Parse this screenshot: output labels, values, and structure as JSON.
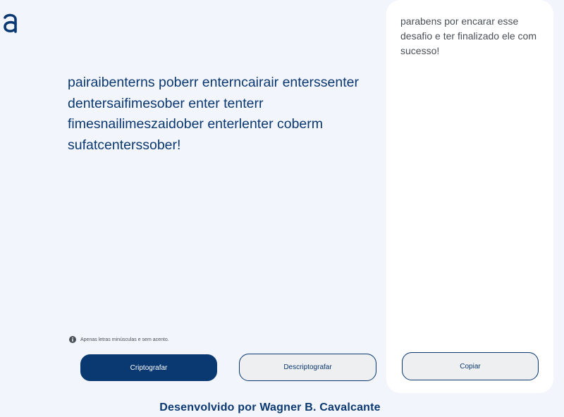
{
  "app": {
    "logo_icon": "alura-logo-icon",
    "accent_color": "#0a3871"
  },
  "input": {
    "text": "pairaibenterns poberr enterncairair enterssenter dentersaifimesober enter tenterr fimesnailimeszaidober enterlenter coberm sufatcenterssober!"
  },
  "hint": {
    "icon": "info-icon",
    "text": "Apenas letras minúsculas e sem acento."
  },
  "buttons": {
    "encrypt_label": "Criptografar",
    "decrypt_label": "Descriptografar"
  },
  "output": {
    "text": "parabens por encarar esse desafio e ter finalizado ele com sucesso!",
    "copy_label": "Copiar"
  },
  "footer": {
    "text": "Desenvolvido por Wagner B. Cavalcante"
  }
}
